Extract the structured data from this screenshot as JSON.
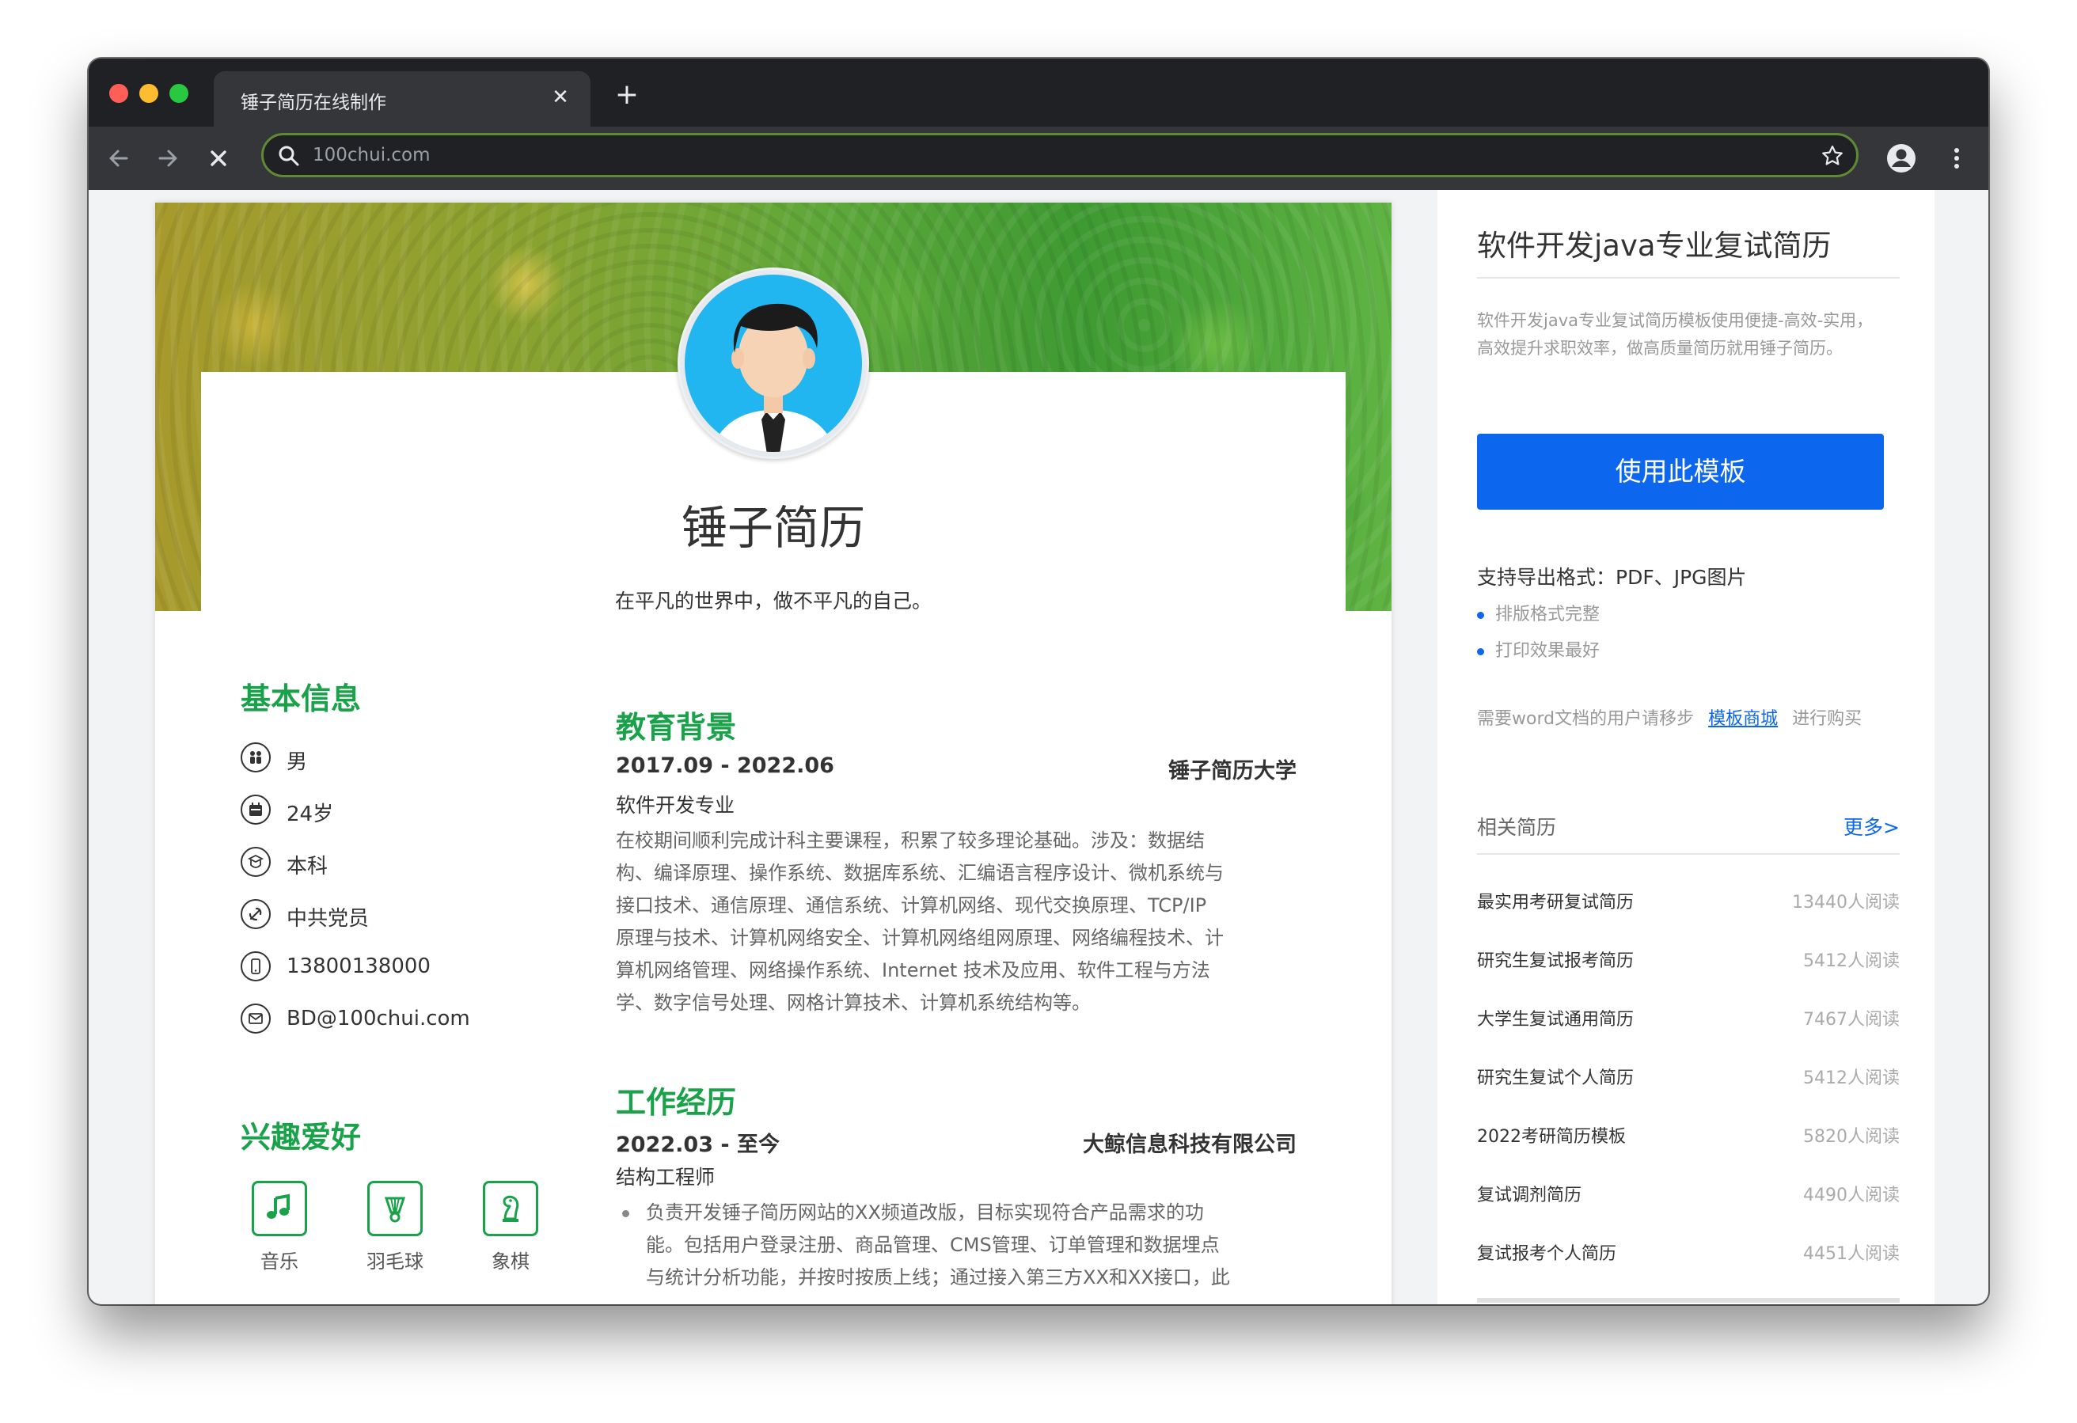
{
  "browser": {
    "tab_title": "锤子简历在线制作",
    "tab_close": "✕",
    "new_tab": "+",
    "url": "100chui.com"
  },
  "resume": {
    "name": "锤子简历",
    "motto": "在平凡的世界中，做不平凡的自己。",
    "basic_info": {
      "title": "基本信息",
      "items": [
        {
          "icon": "gender-icon",
          "text": "男"
        },
        {
          "icon": "calendar-icon",
          "text": "24岁"
        },
        {
          "icon": "education-icon",
          "text": "本科"
        },
        {
          "icon": "party-icon",
          "text": "中共党员"
        },
        {
          "icon": "phone-icon",
          "text": "13800138000"
        },
        {
          "icon": "email-icon",
          "text": "BD@100chui.com"
        }
      ]
    },
    "hobbies": {
      "title": "兴趣爱好",
      "items": [
        {
          "icon": "music-icon",
          "label": "音乐"
        },
        {
          "icon": "badminton-icon",
          "label": "羽毛球"
        },
        {
          "icon": "chess-icon",
          "label": "象棋"
        }
      ]
    },
    "education": {
      "title": "教育背景",
      "date": "2017.09 - 2022.06",
      "school": "锤子简历大学",
      "major": "软件开发专业",
      "lines": [
        "在校期间顺利完成计科主要课程，积累了较多理论基础。涉及：数据结",
        "构、编译原理、操作系统、数据库系统、汇编语言程序设计、微机系统与",
        "接口技术、通信原理、通信系统、计算机网络、现代交换原理、TCP/IP",
        "原理与技术、计算机网络安全、计算机网络组网原理、网络编程技术、计",
        "算机网络管理、网络操作系统、Internet 技术及应用、软件工程与方法",
        "学、数字信号处理、网格计算技术、计算机系统结构等。"
      ]
    },
    "work": {
      "title": "工作经历",
      "date": "2022.03 - 至今",
      "company": "大鲸信息科技有限公司",
      "role": "结构工程师",
      "lines": [
        "负责开发锤子简历网站的XX频道改版，目标实现符合产品需求的功",
        "能。包括用户登录注册、商品管理、CMS管理、订单管理和数据埋点",
        "与统计分析功能，并按时按质上线；通过接入第三方XX和XX接口，此"
      ]
    }
  },
  "sidebar": {
    "template_title": "软件开发java专业复试简历",
    "description": "软件开发java专业复试简历模板使用便捷-高效-实用，高效提升求职效率，做高质量简历就用锤子简历。",
    "use_button": "使用此模板",
    "export_title": "支持导出格式：PDF、JPG图片",
    "features": [
      "排版格式完整",
      "打印效果最好"
    ],
    "note_prefix": "需要word文档的用户请移步",
    "note_link": "模板商城",
    "note_suffix": "进行购买",
    "related_title": "相关简历",
    "more": "更多>",
    "related": [
      {
        "name": "最实用考研复试简历",
        "reads": "13440人阅读"
      },
      {
        "name": "研究生复试报考简历",
        "reads": "5412人阅读"
      },
      {
        "name": "大学生复试通用简历",
        "reads": "7467人阅读"
      },
      {
        "name": "研究生复试个人简历",
        "reads": "5412人阅读"
      },
      {
        "name": "2022考研简历模板",
        "reads": "5820人阅读"
      },
      {
        "name": "复试调剂简历",
        "reads": "4490人阅读"
      },
      {
        "name": "复试报考个人简历",
        "reads": "4451人阅读"
      }
    ]
  },
  "colors": {
    "accent_green": "#1aa24a",
    "brand_blue": "#0d66ee",
    "chrome_dark": "#202124",
    "toolbar": "#35363a"
  }
}
